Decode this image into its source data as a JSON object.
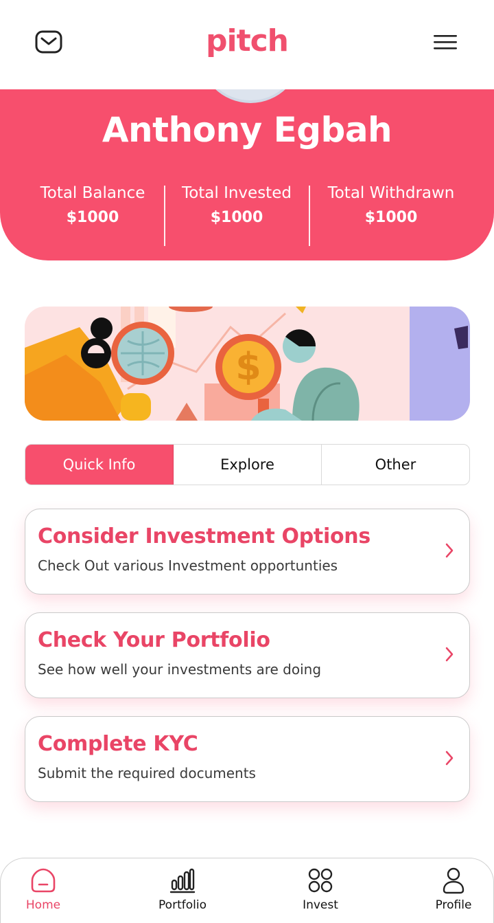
{
  "header": {
    "logo_text": "pitch",
    "mail_icon": "mail-icon",
    "menu_icon": "hamburger-menu-icon"
  },
  "profile": {
    "name": "Anthony Egbah",
    "stats": [
      {
        "label": "Total Balance",
        "value": "$1000"
      },
      {
        "label": "Total Invested",
        "value": "$1000"
      },
      {
        "label": "Total Withdrawn",
        "value": "$1000"
      }
    ]
  },
  "tabs": [
    {
      "label": "Quick Info",
      "active": true
    },
    {
      "label": "Explore",
      "active": false
    },
    {
      "label": "Other",
      "active": false
    }
  ],
  "cards": [
    {
      "title": "Consider Investment Options",
      "description": "Check Out various Investment opportunties"
    },
    {
      "title": "Check Your Portfolio",
      "description": "See how well your investments are doing"
    },
    {
      "title": "Complete KYC",
      "description": "Submit the required documents"
    }
  ],
  "bottom_nav": [
    {
      "label": "Home",
      "icon": "home-icon",
      "active": true
    },
    {
      "label": "Portfolio",
      "icon": "bar-chart-icon",
      "active": false
    },
    {
      "label": "Invest",
      "icon": "grid-circles-icon",
      "active": false
    },
    {
      "label": "Profile",
      "icon": "user-icon",
      "active": false
    }
  ],
  "colors": {
    "brand": "#f74f6d",
    "accent_text": "#e94566",
    "inactive": "#111111"
  }
}
